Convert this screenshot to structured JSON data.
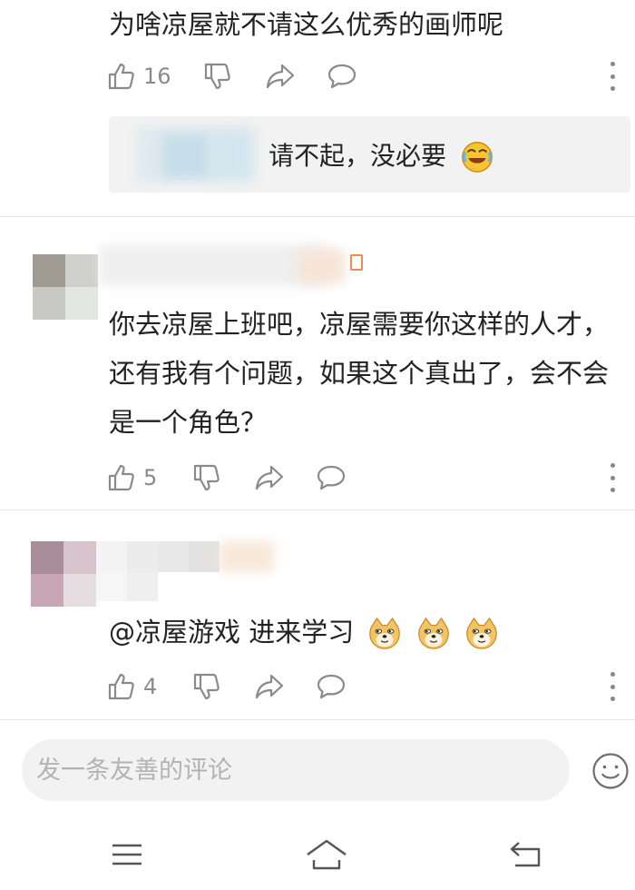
{
  "comments": [
    {
      "text": "为啥凉屋就不请这么优秀的画师呢",
      "like_count": "16",
      "reply": {
        "text": "请不起，没必要"
      }
    },
    {
      "text": "你去凉屋上班吧，凉屋需要你这样的人才，还有我有个问题，如果这个真出了，会不会是一个角色？",
      "like_count": "5"
    },
    {
      "text": "@凉屋游戏 进来学习",
      "like_count": "4"
    }
  ],
  "composer": {
    "placeholder": "发一条友善的评论"
  },
  "colors": {
    "text": "#222222",
    "muted": "#8a8a8a",
    "icon": "#8a8a8a",
    "input_bg": "#f2f2f2"
  },
  "icons": [
    "thumbs-up-icon",
    "thumbs-down-icon",
    "share-icon",
    "comment-icon",
    "more-icon",
    "laughing-emoji",
    "doge-emoji",
    "emoji-icon",
    "menu-icon",
    "home-icon",
    "back-icon"
  ]
}
